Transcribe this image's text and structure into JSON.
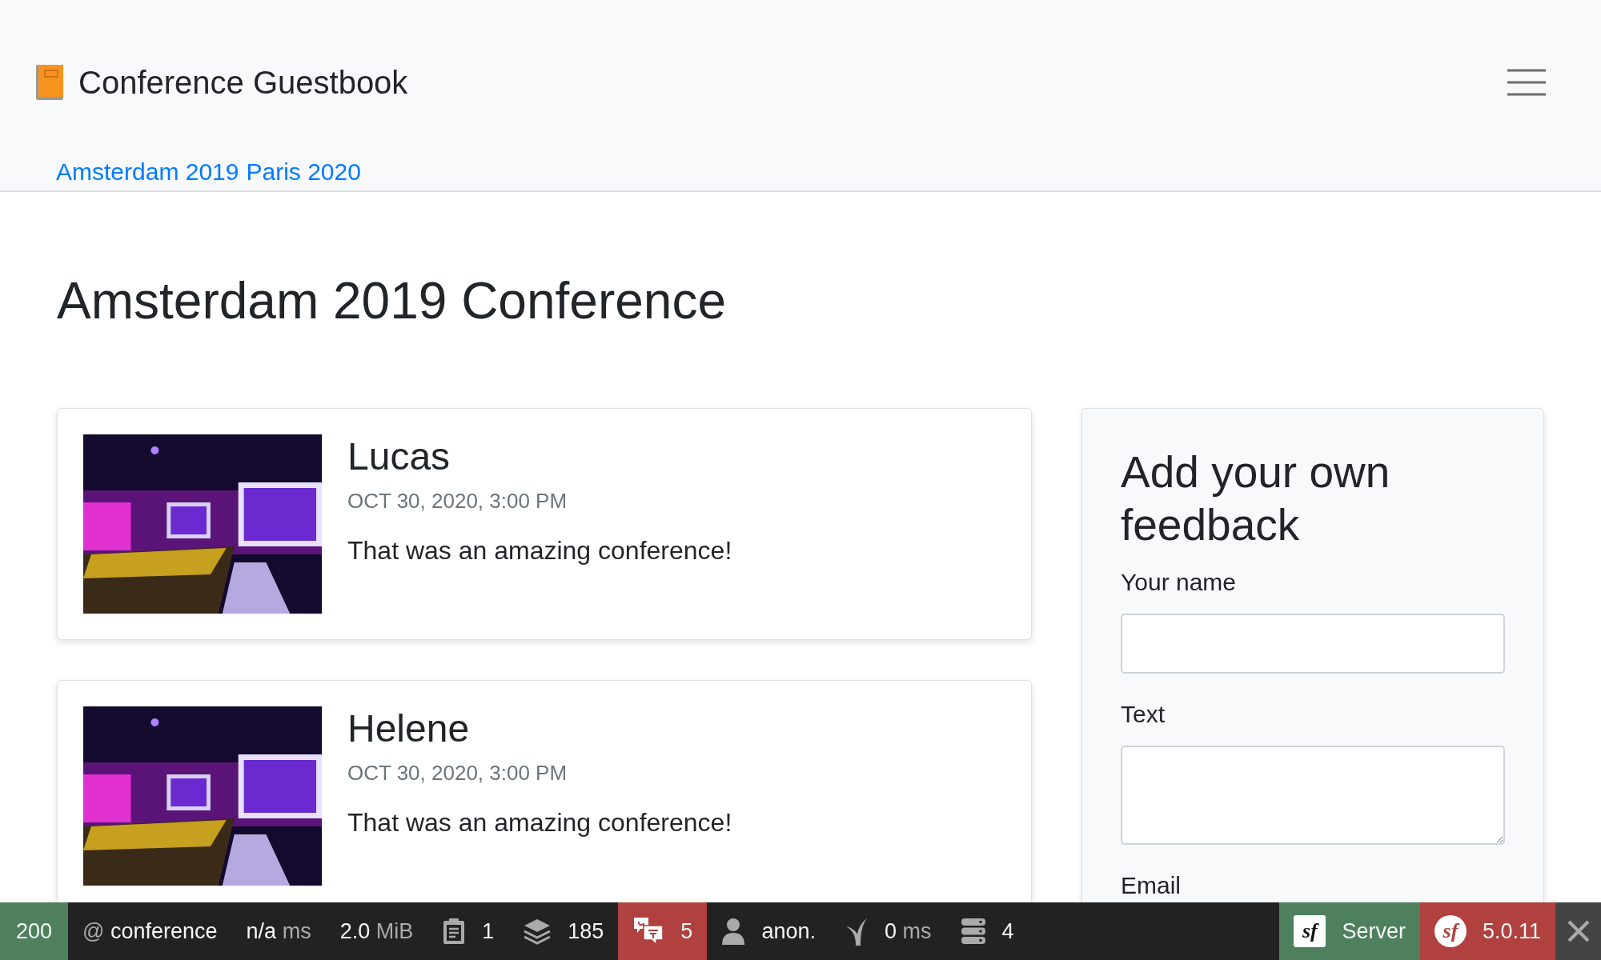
{
  "brand": {
    "title": "Conference Guestbook"
  },
  "nav_links": [
    {
      "label": "Amsterdam 2019"
    },
    {
      "label": "Paris 2020"
    }
  ],
  "heading": "Amsterdam 2019 Conference",
  "comments": [
    {
      "author": "Lucas",
      "date": "OCT 30, 2020, 3:00 PM",
      "text": "That was an amazing conference!"
    },
    {
      "author": "Helene",
      "date": "OCT 30, 2020, 3:00 PM",
      "text": "That was an amazing conference!"
    }
  ],
  "form": {
    "title": "Add your own feedback",
    "fields": [
      {
        "label": "Your name",
        "kind": "input"
      },
      {
        "label": "Text",
        "kind": "textarea"
      },
      {
        "label": "Email"
      }
    ]
  },
  "debug_toolbar": {
    "left_items": [
      {
        "kind": "status",
        "value": "200",
        "color": "#4f805d"
      },
      {
        "kind": "route",
        "symbol": "@",
        "value": "conference"
      },
      {
        "kind": "time",
        "value": "n/a",
        "unit": "ms"
      },
      {
        "kind": "memory",
        "value": "2.0",
        "unit": "MiB"
      },
      {
        "kind": "logs",
        "value": "1"
      },
      {
        "kind": "twig",
        "value": "185"
      },
      {
        "kind": "translation",
        "value": "5",
        "color": "#b0413e"
      },
      {
        "kind": "user",
        "value": "anon."
      },
      {
        "kind": "cache",
        "value": "0",
        "unit": "ms"
      },
      {
        "kind": "db",
        "value": "4"
      }
    ],
    "right_items": [
      {
        "kind": "server",
        "logo": "sf",
        "label": "Server",
        "color": "#4f805d"
      },
      {
        "kind": "version",
        "logo": "sf",
        "label": "5.0.11",
        "color": "#b0413e"
      }
    ]
  }
}
